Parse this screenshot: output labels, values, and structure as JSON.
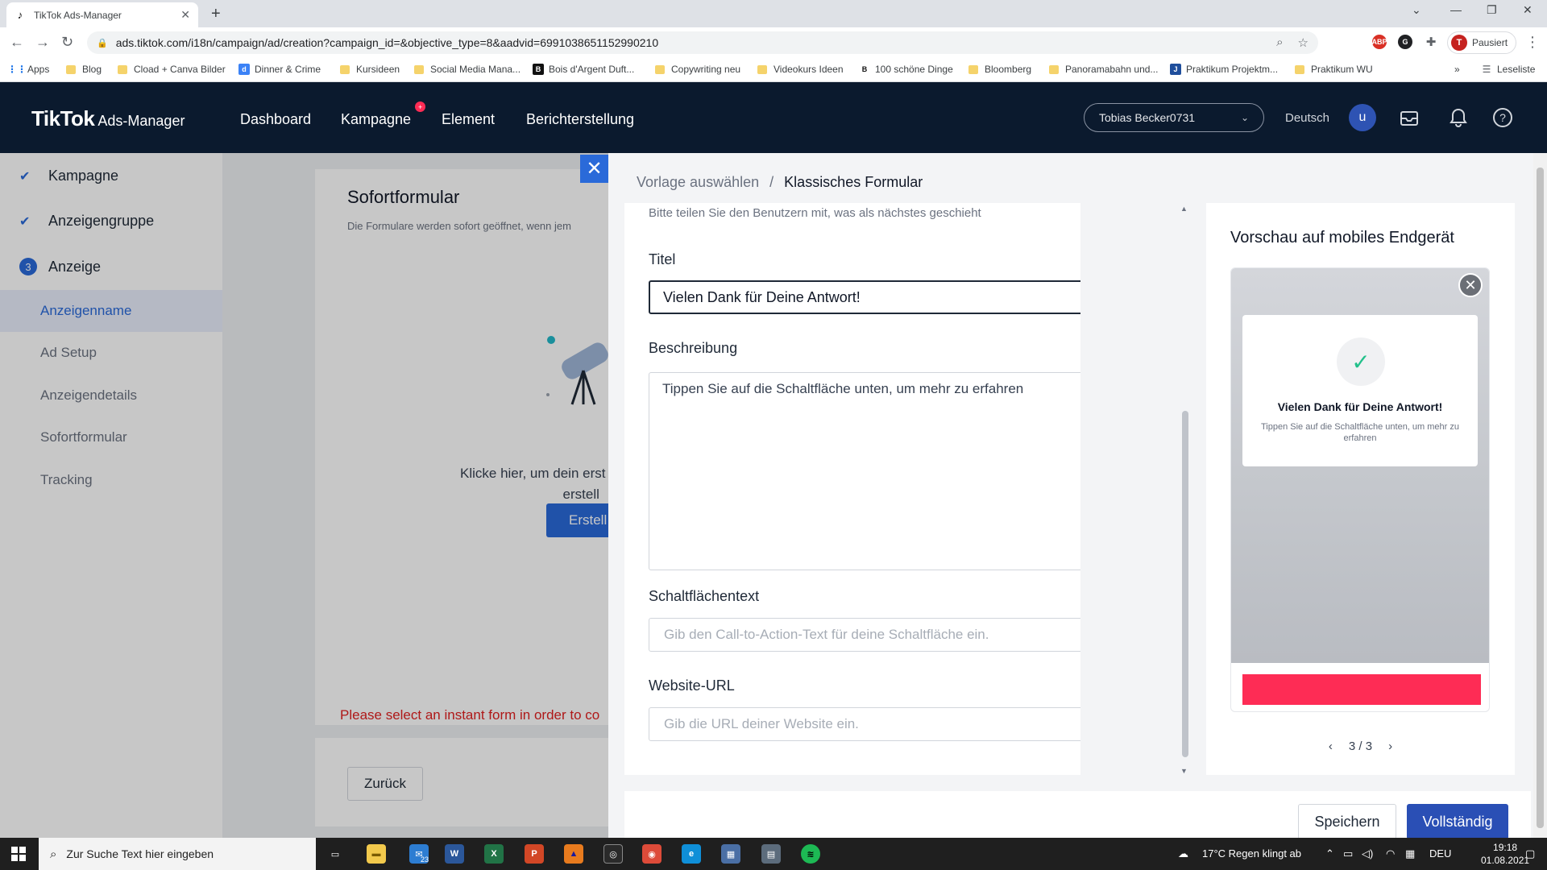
{
  "browser": {
    "tab_title": "TikTok Ads-Manager",
    "url": "ads.tiktok.com/i18n/campaign/ad/creation?campaign_id=&objective_type=8&aadvid=6991038651152990210",
    "profile_label": "Pausiert",
    "profile_initial": "T",
    "bookmarks": [
      "Apps",
      "Blog",
      "Cload + Canva Bilder",
      "Dinner & Crime",
      "Kursideen",
      "Social Media Mana...",
      "Bois d'Argent Duft...",
      "Copywriting neu",
      "Videokurs Ideen",
      "100 schöne Dinge",
      "Bloomberg",
      "Panoramabahn und...",
      "Praktikum Projektm...",
      "Praktikum WU"
    ],
    "reading_list": "Leseliste"
  },
  "header": {
    "brand": "TikTok",
    "brand_sub": "Ads-Manager",
    "nav": [
      "Dashboard",
      "Kampagne",
      "Element",
      "Berichterstellung"
    ],
    "account": "Tobias Becker0731",
    "language": "Deutsch",
    "user_initial": "u"
  },
  "sidebar": {
    "steps": [
      {
        "label": "Kampagne",
        "state": "done"
      },
      {
        "label": "Anzeigengruppe",
        "state": "done"
      },
      {
        "label": "Anzeige",
        "state": "current",
        "number": "3"
      }
    ],
    "substeps": [
      "Anzeigenname",
      "Ad Setup",
      "Anzeigendetails",
      "Sofortformular",
      "Tracking"
    ]
  },
  "background": {
    "section_title": "Sofortformular",
    "section_desc": "Die Formulare werden sofort geöffnet, wenn jem",
    "cta_text_1": "Klicke hier, um dein erst",
    "cta_text_2": "erstell",
    "create_label": "Erstell",
    "error": "Please select an instant form in order to co",
    "back_label": "Zurück"
  },
  "drawer": {
    "breadcrumb_parent": "Vorlage auswählen",
    "breadcrumb_sep": "/",
    "breadcrumb_current": "Klassisches Formular",
    "hint": "Bitte teilen Sie den Benutzern mit, was als nächstes geschieht",
    "title_label": "Titel",
    "title_value": "Vielen Dank für Deine Antwort!",
    "description_label": "Beschreibung",
    "description_value": "Tippen Sie auf die Schaltfläche unten, um mehr zu erfahren",
    "button_text_label": "Schaltflächentext",
    "button_text_placeholder": "Gib den Call-to-Action-Text für deine Schaltfläche ein.",
    "url_label": "Website-URL",
    "url_placeholder": "Gib die URL deiner Website ein.",
    "save_label": "Speichern",
    "complete_label": "Vollständig"
  },
  "preview": {
    "heading": "Vorschau auf mobiles Endgerät",
    "card_title": "Vielen Dank für Deine Antwort!",
    "card_desc": "Tippen Sie auf die Schaltfläche unten, um mehr zu erfahren",
    "pager": "3 / 3"
  },
  "taskbar": {
    "search_placeholder": "Zur Suche Text hier eingeben",
    "weather": "17°C  Regen klingt ab",
    "lang": "DEU",
    "time": "19:18",
    "date": "01.08.2021",
    "mail_badge": "23"
  },
  "colors": {
    "header_bg": "#0b1a2e",
    "primary": "#2a6ad9",
    "tiktok_pink": "#fe2c55",
    "error": "#e02020"
  }
}
